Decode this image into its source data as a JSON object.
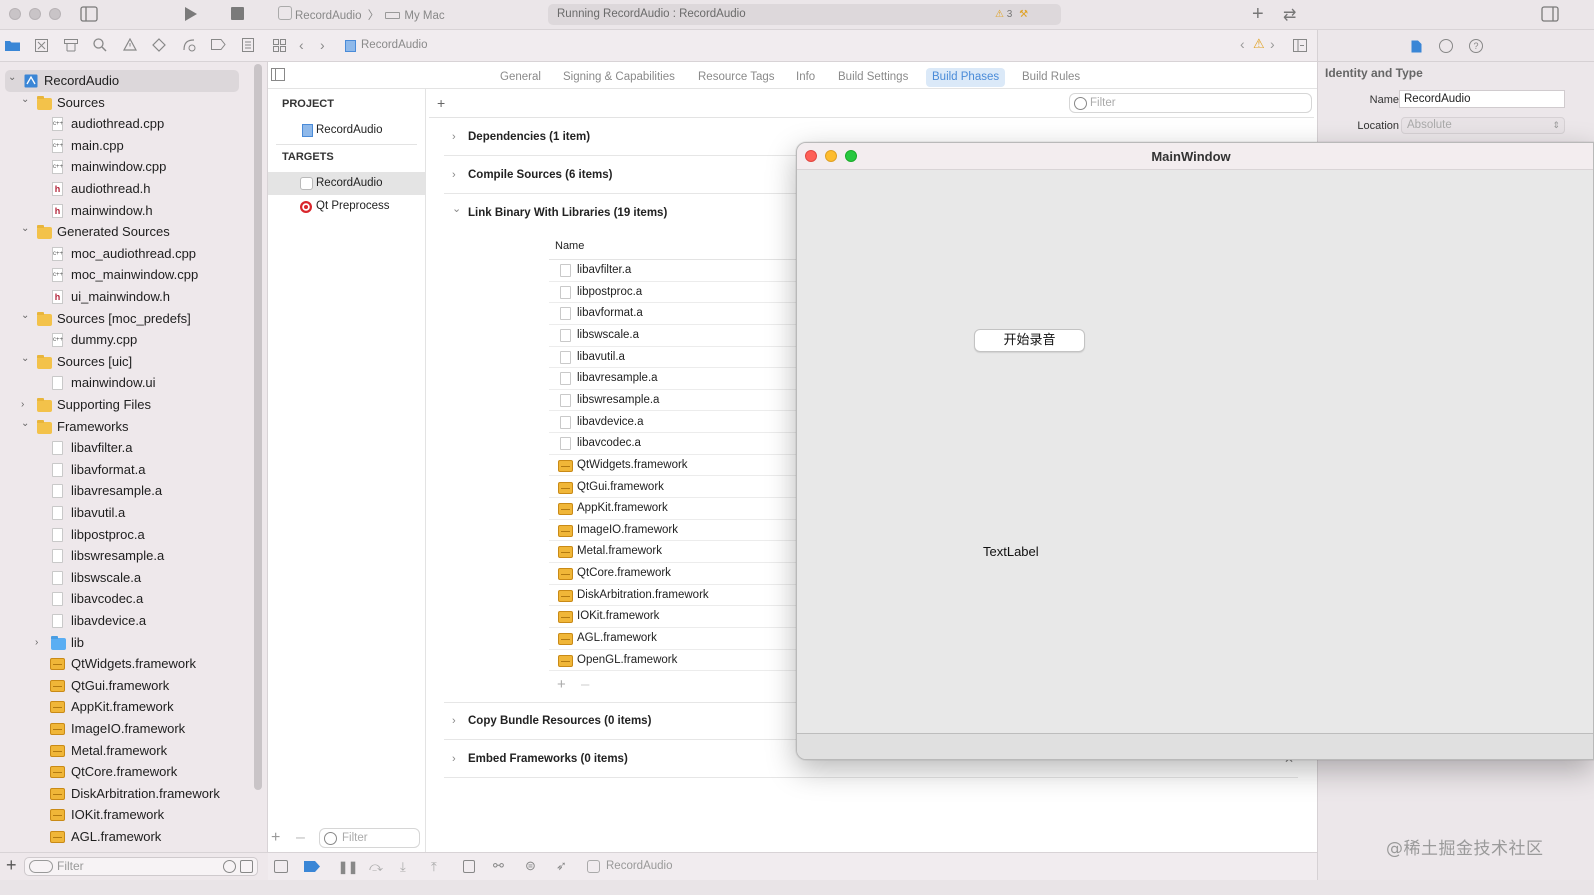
{
  "window": {
    "scheme_target": "RecordAudio",
    "destination": "My Mac",
    "activity_status": "Running RecordAudio : RecordAudio",
    "warnings_count": "3"
  },
  "jump_bar": {
    "path": "RecordAudio"
  },
  "navigator": {
    "items": [
      {
        "label": "RecordAudio",
        "kind": "project",
        "level": 0,
        "expanded": true
      },
      {
        "label": "Sources",
        "kind": "folder",
        "level": 1,
        "expanded": true
      },
      {
        "label": "audiothread.cpp",
        "kind": "cpp",
        "level": 2
      },
      {
        "label": "main.cpp",
        "kind": "cpp",
        "level": 2
      },
      {
        "label": "mainwindow.cpp",
        "kind": "cpp",
        "level": 2
      },
      {
        "label": "audiothread.h",
        "kind": "h",
        "level": 2
      },
      {
        "label": "mainwindow.h",
        "kind": "h",
        "level": 2
      },
      {
        "label": "Generated Sources",
        "kind": "folder",
        "level": 1,
        "expanded": true
      },
      {
        "label": "moc_audiothread.cpp",
        "kind": "cpp",
        "level": 2
      },
      {
        "label": "moc_mainwindow.cpp",
        "kind": "cpp",
        "level": 2
      },
      {
        "label": "ui_mainwindow.h",
        "kind": "h",
        "level": 2
      },
      {
        "label": "Sources [moc_predefs]",
        "kind": "folder",
        "level": 1,
        "expanded": true
      },
      {
        "label": "dummy.cpp",
        "kind": "cpp",
        "level": 2
      },
      {
        "label": "Sources [uic]",
        "kind": "folder",
        "level": 1,
        "expanded": true
      },
      {
        "label": "mainwindow.ui",
        "kind": "doc",
        "level": 2
      },
      {
        "label": "Supporting Files",
        "kind": "folder",
        "level": 1,
        "expanded": false
      },
      {
        "label": "Frameworks",
        "kind": "folder",
        "level": 1,
        "expanded": true
      },
      {
        "label": "libavfilter.a",
        "kind": "doc",
        "level": 2
      },
      {
        "label": "libavformat.a",
        "kind": "doc",
        "level": 2
      },
      {
        "label": "libavresample.a",
        "kind": "doc",
        "level": 2
      },
      {
        "label": "libavutil.a",
        "kind": "doc",
        "level": 2
      },
      {
        "label": "libpostproc.a",
        "kind": "doc",
        "level": 2
      },
      {
        "label": "libswresample.a",
        "kind": "doc",
        "level": 2
      },
      {
        "label": "libswscale.a",
        "kind": "doc",
        "level": 2
      },
      {
        "label": "libavcodec.a",
        "kind": "doc",
        "level": 2
      },
      {
        "label": "libavdevice.a",
        "kind": "doc",
        "level": 2
      },
      {
        "label": "lib",
        "kind": "bluefolder",
        "level": 2,
        "expanded": false
      },
      {
        "label": "QtWidgets.framework",
        "kind": "framework",
        "level": 2
      },
      {
        "label": "QtGui.framework",
        "kind": "framework",
        "level": 2
      },
      {
        "label": "AppKit.framework",
        "kind": "framework",
        "level": 2
      },
      {
        "label": "ImageIO.framework",
        "kind": "framework",
        "level": 2
      },
      {
        "label": "Metal.framework",
        "kind": "framework",
        "level": 2
      },
      {
        "label": "QtCore.framework",
        "kind": "framework",
        "level": 2
      },
      {
        "label": "DiskArbitration.framework",
        "kind": "framework",
        "level": 2
      },
      {
        "label": "IOKit.framework",
        "kind": "framework",
        "level": 2
      },
      {
        "label": "AGL.framework",
        "kind": "framework",
        "level": 2
      }
    ],
    "filter_placeholder": "Filter"
  },
  "editor_tabs": [
    {
      "label": "General",
      "active": false
    },
    {
      "label": "Signing & Capabilities",
      "active": false
    },
    {
      "label": "Resource Tags",
      "active": false
    },
    {
      "label": "Info",
      "active": false
    },
    {
      "label": "Build Settings",
      "active": false
    },
    {
      "label": "Build Phases",
      "active": true
    },
    {
      "label": "Build Rules",
      "active": false
    }
  ],
  "targets_pane": {
    "project_header": "PROJECT",
    "project_item": "RecordAudio",
    "targets_header": "TARGETS",
    "targets": [
      "RecordAudio",
      "Qt Preprocess"
    ],
    "filter_placeholder": "Filter"
  },
  "build_phases": {
    "add_label": "+",
    "filter_placeholder": "Filter",
    "phases": [
      {
        "label": "Dependencies (1 item)",
        "expanded": false
      },
      {
        "label": "Compile Sources (6 items)",
        "expanded": false
      },
      {
        "label": "Link Binary With Libraries (19 items)",
        "expanded": true
      },
      {
        "label": "Copy Bundle Resources (0 items)",
        "expanded": false
      },
      {
        "label": "Embed Frameworks (0 items)",
        "expanded": false
      }
    ],
    "libraries_column_header": "Name",
    "libraries": [
      {
        "name": "libavfilter.a",
        "kind": "doc"
      },
      {
        "name": "libpostproc.a",
        "kind": "doc"
      },
      {
        "name": "libavformat.a",
        "kind": "doc"
      },
      {
        "name": "libswscale.a",
        "kind": "doc"
      },
      {
        "name": "libavutil.a",
        "kind": "doc"
      },
      {
        "name": "libavresample.a",
        "kind": "doc"
      },
      {
        "name": "libswresample.a",
        "kind": "doc"
      },
      {
        "name": "libavdevice.a",
        "kind": "doc"
      },
      {
        "name": "libavcodec.a",
        "kind": "doc"
      },
      {
        "name": "QtWidgets.framework",
        "kind": "framework"
      },
      {
        "name": "QtGui.framework",
        "kind": "framework"
      },
      {
        "name": "AppKit.framework",
        "kind": "framework"
      },
      {
        "name": "ImageIO.framework",
        "kind": "framework"
      },
      {
        "name": "Metal.framework",
        "kind": "framework"
      },
      {
        "name": "QtCore.framework",
        "kind": "framework"
      },
      {
        "name": "DiskArbitration.framework",
        "kind": "framework"
      },
      {
        "name": "IOKit.framework",
        "kind": "framework"
      },
      {
        "name": "AGL.framework",
        "kind": "framework"
      },
      {
        "name": "OpenGL.framework",
        "kind": "framework"
      }
    ]
  },
  "inspector": {
    "section_title": "Identity and Type",
    "name_label": "Name",
    "name_value": "RecordAudio",
    "location_label": "Location",
    "location_value": "Absolute"
  },
  "debug_bar": {
    "process": "RecordAudio"
  },
  "qt_window": {
    "title": "MainWindow",
    "button_label": "开始录音",
    "text_label": "TextLabel"
  },
  "watermark": "@稀土掘金技术社区",
  "colors": {
    "accent_blue": "#4a8bd8",
    "tab_active_bg": "#dbe9f8",
    "folder_yellow": "#f3c24a",
    "warning_yellow": "#f0b429",
    "close_red": "#fe5f57",
    "minimize_yellow": "#febc2e",
    "zoom_green": "#28c840"
  }
}
